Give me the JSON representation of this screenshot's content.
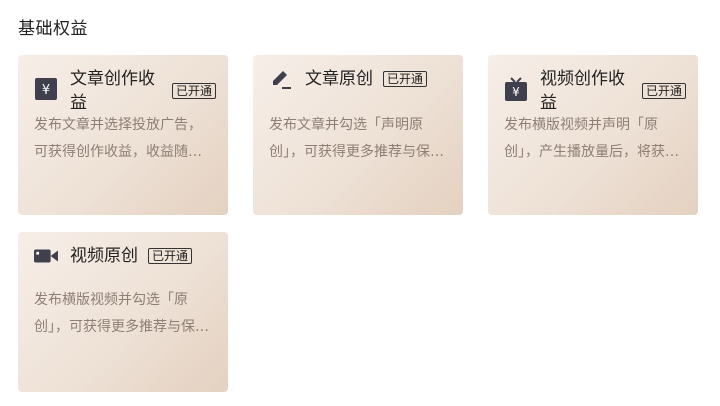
{
  "section_title": "基础权益",
  "cards": [
    {
      "icon": "yen-icon",
      "title": "文章创作收益",
      "badge": "已开通",
      "desc": "发布文章并选择投放广告，可获得创作收益，收益随阅读量增长"
    },
    {
      "icon": "pen-icon",
      "title": "文章原创",
      "badge": "已开通",
      "desc": "发布文章并勾选「声明原创」，可获得更多推荐与保护权益"
    },
    {
      "icon": "tv-yen-icon",
      "title": "视频创作收益",
      "badge": "已开通",
      "desc": "发布横版视频并声明「原创」，产生播放量后，将获得创作收益"
    },
    {
      "icon": "video-camera-icon",
      "title": "视频原创",
      "badge": "已开通",
      "desc": "发布横版视频并勾选「原创」，可获得更多推荐与保护权益"
    }
  ]
}
